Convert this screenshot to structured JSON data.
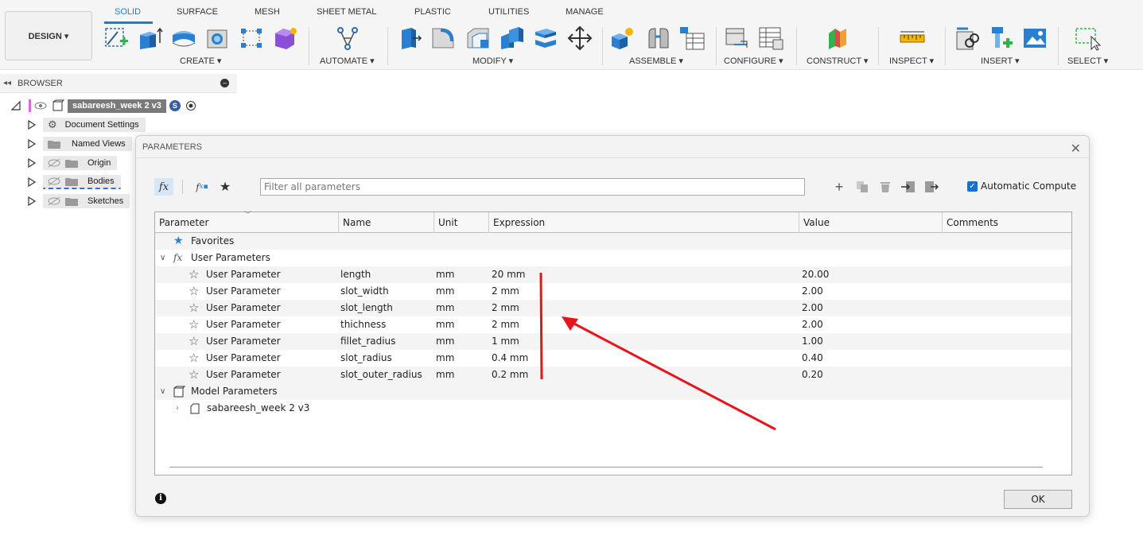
{
  "toolbar": {
    "design_label": "DESIGN ▾",
    "tabs": [
      {
        "label": "SOLID",
        "active": true
      },
      {
        "label": "SURFACE"
      },
      {
        "label": "MESH"
      },
      {
        "label": "SHEET METAL"
      },
      {
        "label": "PLASTIC"
      },
      {
        "label": "UTILITIES"
      },
      {
        "label": "MANAGE"
      }
    ],
    "groups": {
      "create": "CREATE ▾",
      "automate": "AUTOMATE ▾",
      "modify": "MODIFY ▾",
      "assemble": "ASSEMBLE ▾",
      "configure": "CONFIGURE ▾",
      "construct": "CONSTRUCT ▾",
      "inspect": "INSPECT ▾",
      "insert": "INSERT ▾",
      "select": "SELECT ▾"
    },
    "accent_color": "#1e7bd7"
  },
  "browser": {
    "title": "BROWSER",
    "root": "sabareesh_week 2 v3",
    "items": [
      {
        "label": "Document Settings"
      },
      {
        "label": "Named Views"
      },
      {
        "label": "Origin"
      },
      {
        "label": "Bodies"
      },
      {
        "label": "Sketches"
      }
    ]
  },
  "dialog": {
    "title": "PARAMETERS",
    "filter_placeholder": "Filter all parameters",
    "automatic_compute": "Automatic Compute",
    "columns": [
      "Parameter",
      "Name",
      "Unit",
      "Expression",
      "Value",
      "Comments"
    ],
    "favorites_label": "Favorites",
    "user_params_label": "User Parameters",
    "user_params": [
      {
        "type": "User Parameter",
        "name": "length",
        "unit": "mm",
        "expression": "20 mm",
        "value": "20.00"
      },
      {
        "type": "User Parameter",
        "name": "slot_width",
        "unit": "mm",
        "expression": "2 mm",
        "value": "2.00"
      },
      {
        "type": "User Parameter",
        "name": "slot_length",
        "unit": "mm",
        "expression": "2 mm",
        "value": "2.00"
      },
      {
        "type": "User Parameter",
        "name": "thichness",
        "unit": "mm",
        "expression": "2 mm",
        "value": "2.00"
      },
      {
        "type": "User Parameter",
        "name": "fillet_radius",
        "unit": "mm",
        "expression": "1 mm",
        "value": "1.00"
      },
      {
        "type": "User Parameter",
        "name": "slot_radius",
        "unit": "mm",
        "expression": "0.4 mm",
        "value": "0.40"
      },
      {
        "type": "User Parameter",
        "name": "slot_outer_radius",
        "unit": "mm",
        "expression": "0.2 mm",
        "value": "0.20"
      }
    ],
    "model_params_label": "Model Parameters",
    "model_component": "sabareesh_week 2 v3",
    "ok_label": "OK"
  },
  "annotation_color": "#e8141b"
}
